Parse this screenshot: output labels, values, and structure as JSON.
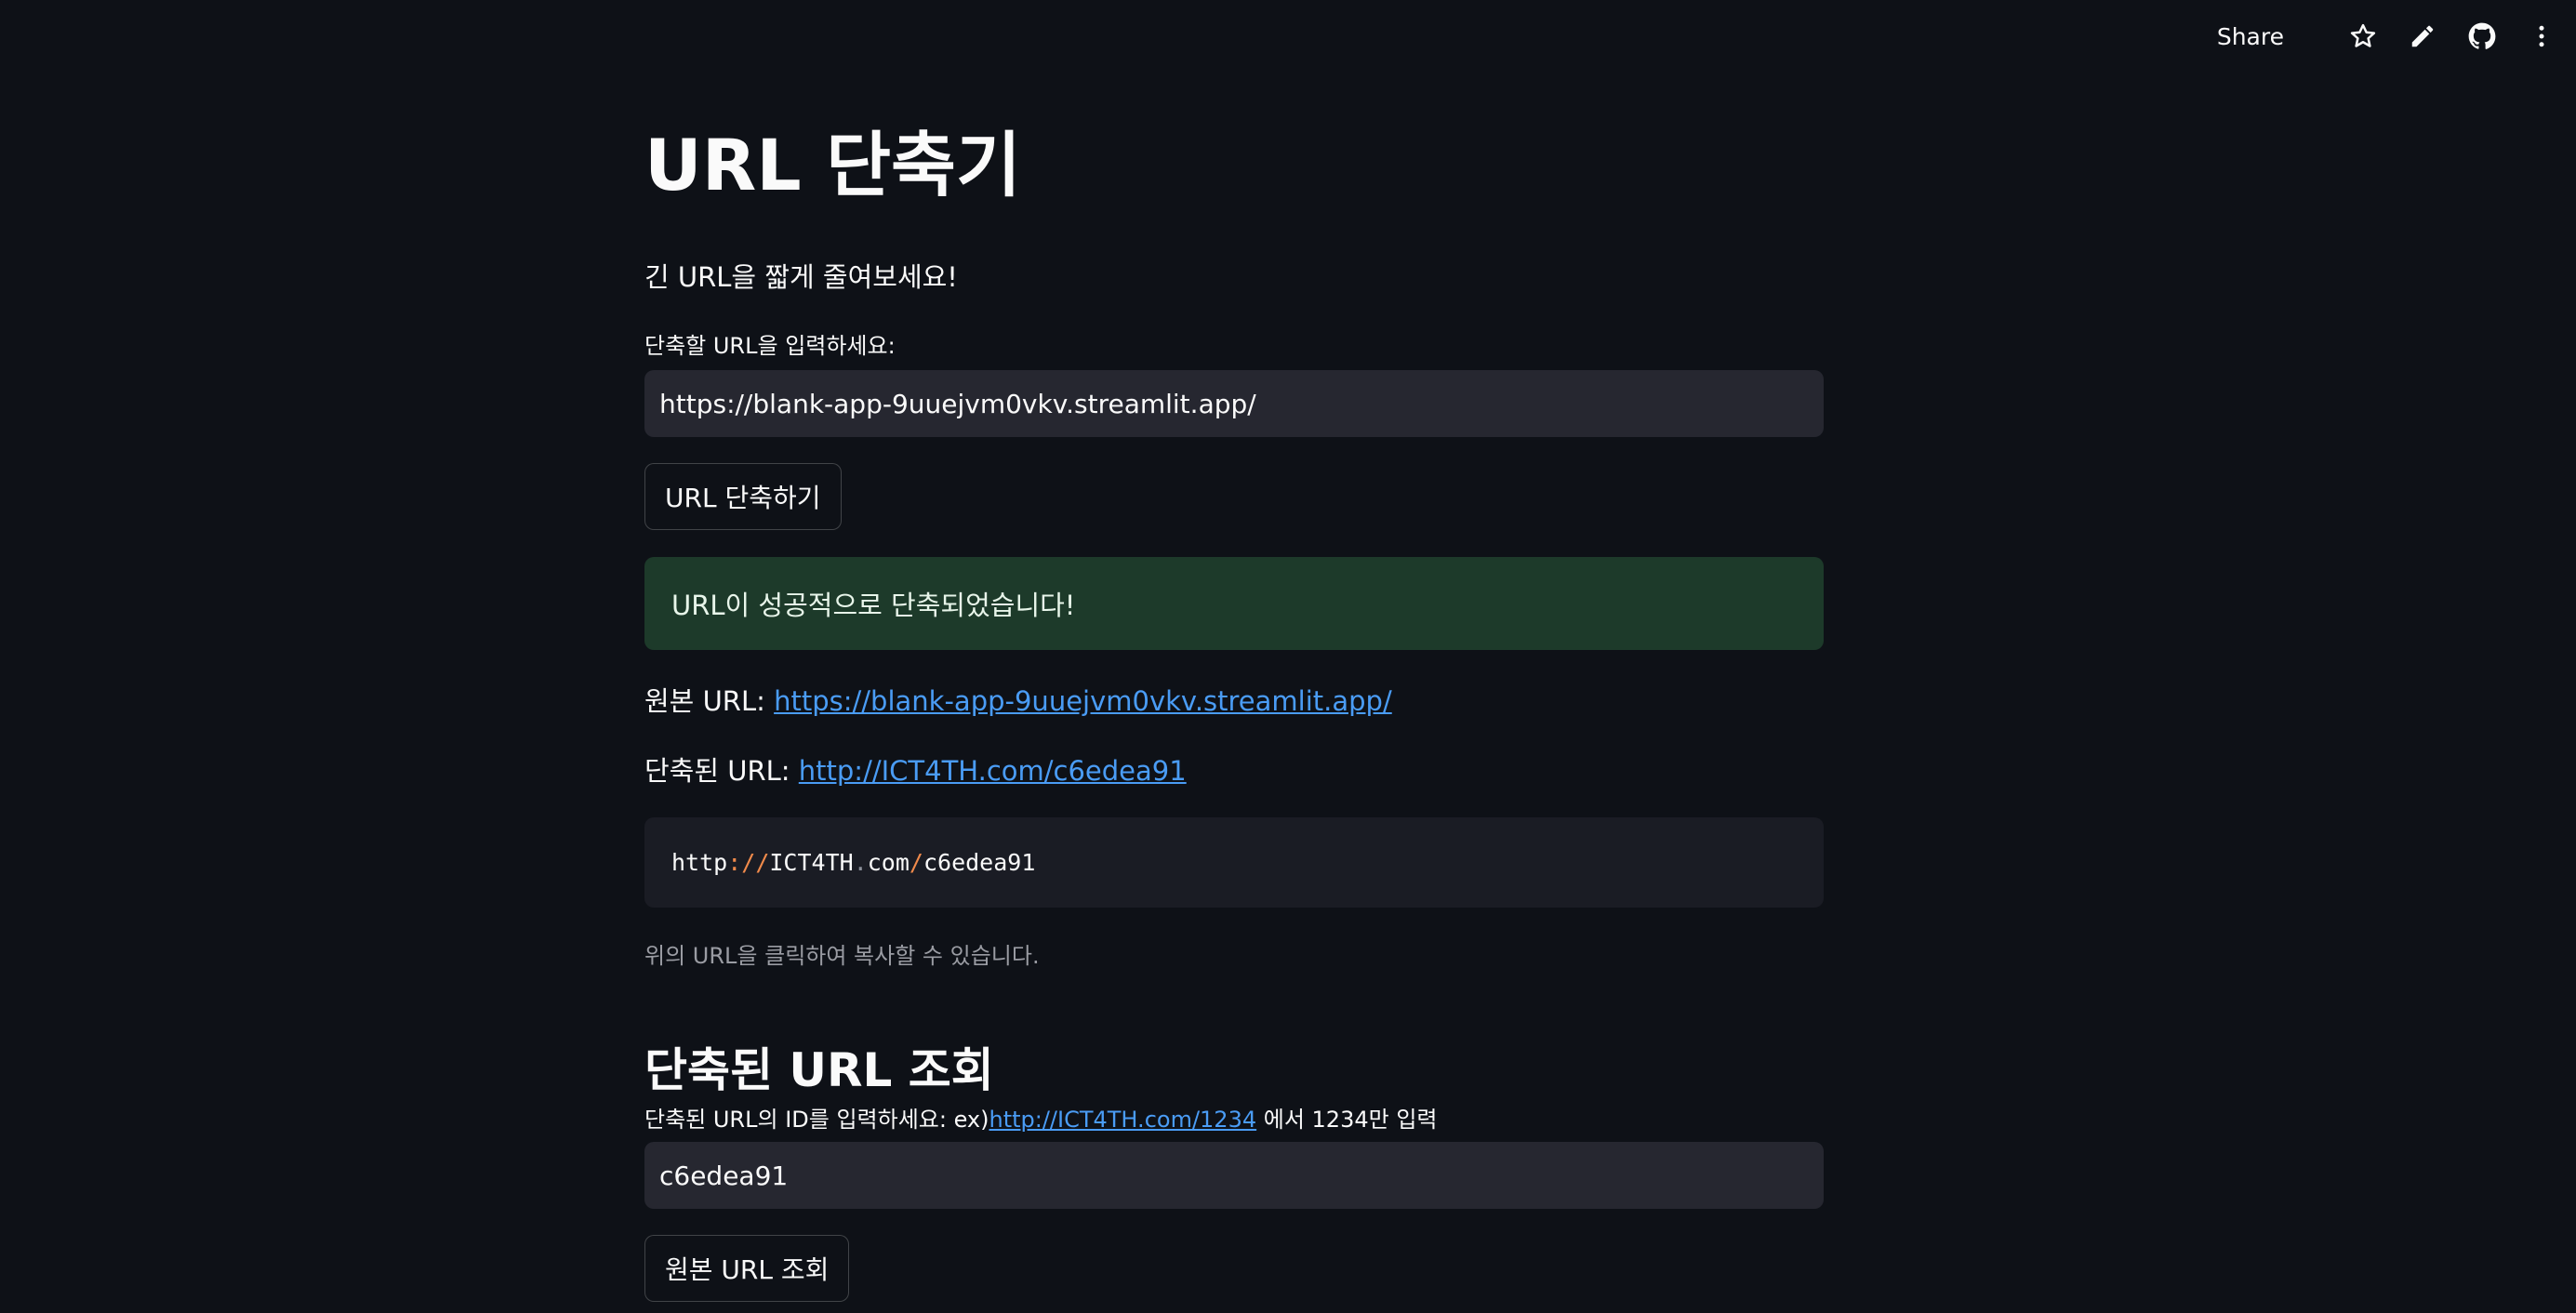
{
  "toolbar": {
    "share_label": "Share",
    "icons": [
      "star-icon",
      "pencil-icon",
      "github-icon",
      "more-vertical-icon"
    ]
  },
  "app": {
    "title": "URL 단축기",
    "subtitle": "긴 URL을 짧게 줄여보세요!"
  },
  "shorten_form": {
    "input_label": "단축할 URL을 입력하세요:",
    "input_value": "https://blank-app-9uuejvm0vkv.streamlit.app/",
    "button_label": "URL 단축하기"
  },
  "result": {
    "success_message": "URL이 성공적으로 단축되었습니다!",
    "original_label": "원본 URL: ",
    "original_url": "https://blank-app-9uuejvm0vkv.streamlit.app/",
    "short_label": "단축된 URL: ",
    "short_url": "http://ICT4TH.com/c6edea91",
    "code": {
      "scheme": "http",
      "sep1": "://",
      "host1": "ICT4TH",
      "dot": ".",
      "host2": "com",
      "slash": "/",
      "path": "c6edea91"
    },
    "copy_hint": "위의 URL을 클릭하여 복사할 수 있습니다."
  },
  "lookup": {
    "heading": "단축된 URL 조회",
    "label_prefix": "단축된 URL의 ID를 입력하세요: ex)",
    "label_link": "http://ICT4TH.com/1234",
    "label_suffix": " 에서 1234만 입력",
    "input_value": "c6edea91",
    "button_label": "원본 URL 조회"
  },
  "colors": {
    "background": "#0e1117",
    "input_bg": "#262730",
    "success_bg": "#1d3a2a",
    "link": "#4a9cf5",
    "code_punct": "#f08a4b"
  }
}
